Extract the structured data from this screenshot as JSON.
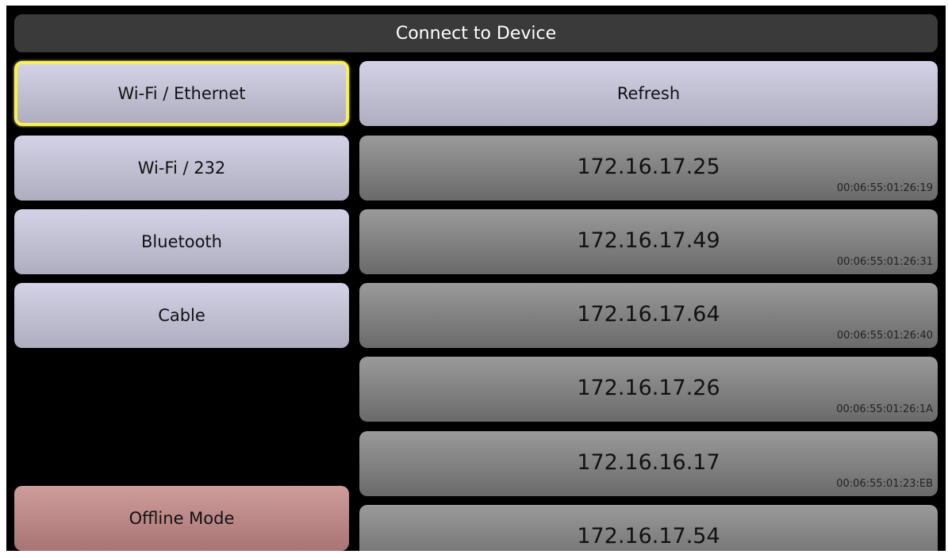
{
  "header": {
    "title": "Connect to Device"
  },
  "connection_modes": [
    {
      "label": "Wi-Fi / Ethernet",
      "selected": true
    },
    {
      "label": "Wi-Fi / 232",
      "selected": false
    },
    {
      "label": "Bluetooth",
      "selected": false
    },
    {
      "label": "Cable",
      "selected": false
    }
  ],
  "offline": {
    "label": "Offline Mode"
  },
  "refresh": {
    "label": "Refresh"
  },
  "devices": [
    {
      "ip": "172.16.17.25",
      "mac": "00:06:55:01:26:19"
    },
    {
      "ip": "172.16.17.49",
      "mac": "00:06:55:01:26:31"
    },
    {
      "ip": "172.16.17.64",
      "mac": "00:06:55:01:26:40"
    },
    {
      "ip": "172.16.17.26",
      "mac": "00:06:55:01:26:1A"
    },
    {
      "ip": "172.16.16.17",
      "mac": "00:06:55:01:23:EB"
    },
    {
      "ip": "172.16.17.54",
      "mac": ""
    }
  ],
  "colors": {
    "selected_border": "#f5f05a",
    "offline_button": "#b88484",
    "mode_button": "#c2c1d4",
    "device_row": "#828282"
  }
}
